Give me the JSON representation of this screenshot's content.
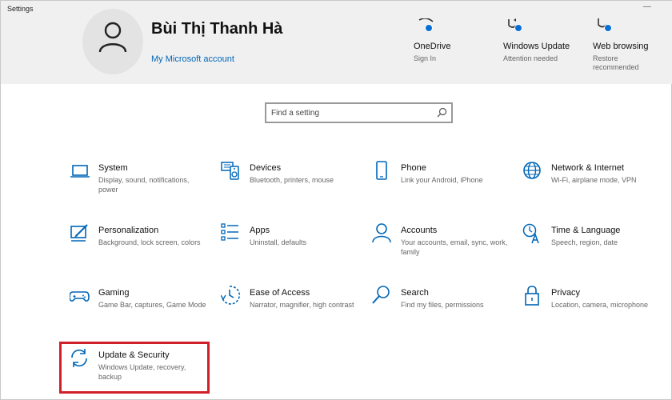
{
  "window": {
    "title": "Settings",
    "minimize_glyph": "—"
  },
  "profile": {
    "name": "Bùi Thị Thanh Hà",
    "account_link": "My Microsoft account"
  },
  "quick_status": [
    {
      "title": "OneDrive",
      "subtitle": "Sign In",
      "icon": "onedrive-icon"
    },
    {
      "title": "Windows Update",
      "subtitle": "Attention needed",
      "icon": "windows-update-icon"
    },
    {
      "title": "Web browsing",
      "subtitle": "Restore recommended",
      "icon": "web-browsing-icon"
    }
  ],
  "search": {
    "placeholder": "Find a setting"
  },
  "categories": [
    {
      "title": "System",
      "desc": "Display, sound, notifications, power",
      "icon": "laptop-icon"
    },
    {
      "title": "Devices",
      "desc": "Bluetooth, printers, mouse",
      "icon": "devices-icon"
    },
    {
      "title": "Phone",
      "desc": "Link your Android, iPhone",
      "icon": "phone-icon"
    },
    {
      "title": "Network & Internet",
      "desc": "Wi-Fi, airplane mode, VPN",
      "icon": "globe-icon"
    },
    {
      "title": "Personalization",
      "desc": "Background, lock screen, colors",
      "icon": "personalization-icon"
    },
    {
      "title": "Apps",
      "desc": "Uninstall, defaults",
      "icon": "apps-list-icon"
    },
    {
      "title": "Accounts",
      "desc": "Your accounts, email, sync, work, family",
      "icon": "person-icon"
    },
    {
      "title": "Time & Language",
      "desc": "Speech, region, date",
      "icon": "time-language-icon"
    },
    {
      "title": "Gaming",
      "desc": "Game Bar, captures, Game Mode",
      "icon": "gamepad-icon"
    },
    {
      "title": "Ease of Access",
      "desc": "Narrator, magnifier, high contrast",
      "icon": "ease-of-access-icon"
    },
    {
      "title": "Search",
      "desc": "Find my files, permissions",
      "icon": "search-icon"
    },
    {
      "title": "Privacy",
      "desc": "Location, camera, microphone",
      "icon": "lock-icon"
    },
    {
      "title": "Update & Security",
      "desc": "Windows Update, recovery, backup",
      "icon": "sync-icon"
    }
  ],
  "colors": {
    "accent": "#0067b8",
    "highlight": "#d0202a",
    "header_bg": "#f0f0f0"
  }
}
